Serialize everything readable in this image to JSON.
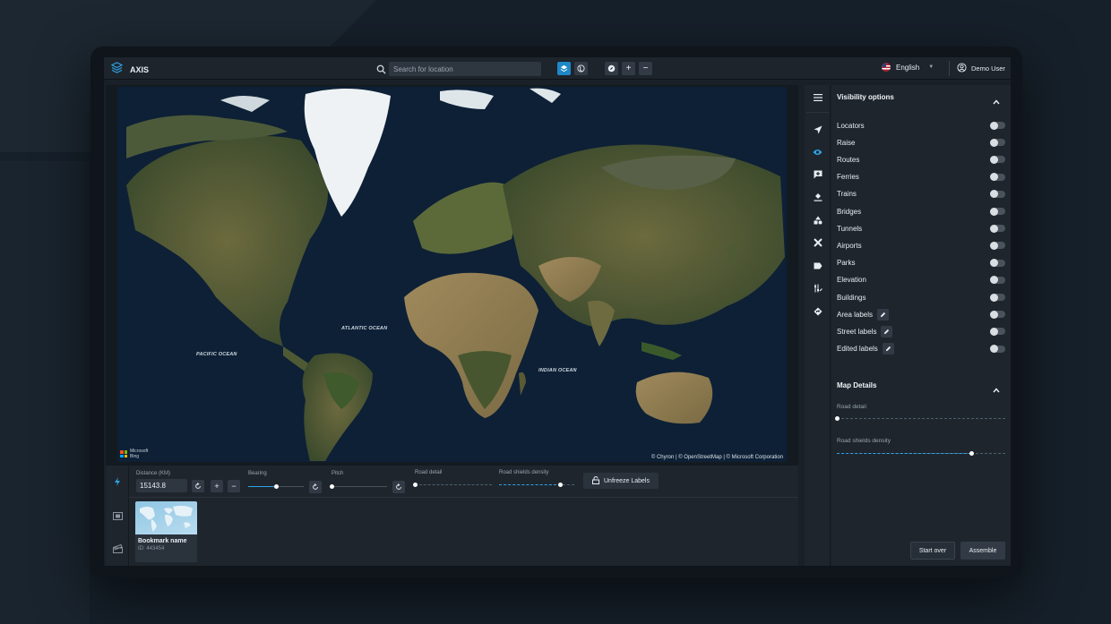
{
  "app": {
    "name": "AXIS"
  },
  "search": {
    "placeholder": "Search for location"
  },
  "topbar": {
    "language": "English",
    "user": "Demo User"
  },
  "map": {
    "ocean_labels": [
      "ATLANTIC OCEAN",
      "PACIFIC OCEAN",
      "INDIAN OCEAN"
    ],
    "attribution": "© Chyron | © OpenStreetMap | © Microsoft Corporation",
    "provider_line1": "Microsoft",
    "provider_line2": "Bing"
  },
  "controls": {
    "distance_label": "Distance (KM)",
    "distance_value": "15143.8",
    "bearing_label": "Bearing",
    "bearing_level": 0.5,
    "pitch_label": "Pitch",
    "pitch_level": 0.0,
    "road_detail_label": "Road detail",
    "road_detail_level": 0.0,
    "road_shields_label": "Road shields density",
    "road_shields_level": 0.82,
    "unfreeze_label": "Unfreeze Labels"
  },
  "bookmark": {
    "name": "Bookmark name",
    "id": "ID: 443454"
  },
  "visibility": {
    "title": "Visibility options",
    "options": [
      {
        "label": "Locators",
        "editable": false
      },
      {
        "label": "Raise",
        "editable": false
      },
      {
        "label": "Routes",
        "editable": false
      },
      {
        "label": "Ferries",
        "editable": false
      },
      {
        "label": "Trains",
        "editable": false
      },
      {
        "label": "Bridges",
        "editable": false
      },
      {
        "label": "Tunnels",
        "editable": false
      },
      {
        "label": "Airports",
        "editable": false
      },
      {
        "label": "Parks",
        "editable": false
      },
      {
        "label": "Elevation",
        "editable": false
      },
      {
        "label": "Buildings",
        "editable": false
      },
      {
        "label": "Area labels",
        "editable": true
      },
      {
        "label": "Street labels",
        "editable": true
      },
      {
        "label": "Edited labels",
        "editable": true
      }
    ]
  },
  "map_details": {
    "title": "Map Details",
    "road_detail_label": "Road detail",
    "road_detail_level": 0.0,
    "road_shields_label": "Road shields density",
    "road_shields_level": 0.8
  },
  "actions": {
    "start_over": "Start over",
    "assemble": "Assemble"
  },
  "colors": {
    "accent": "#1e88c8",
    "slider": "#2fa3e6",
    "panel": "#1e252d"
  }
}
